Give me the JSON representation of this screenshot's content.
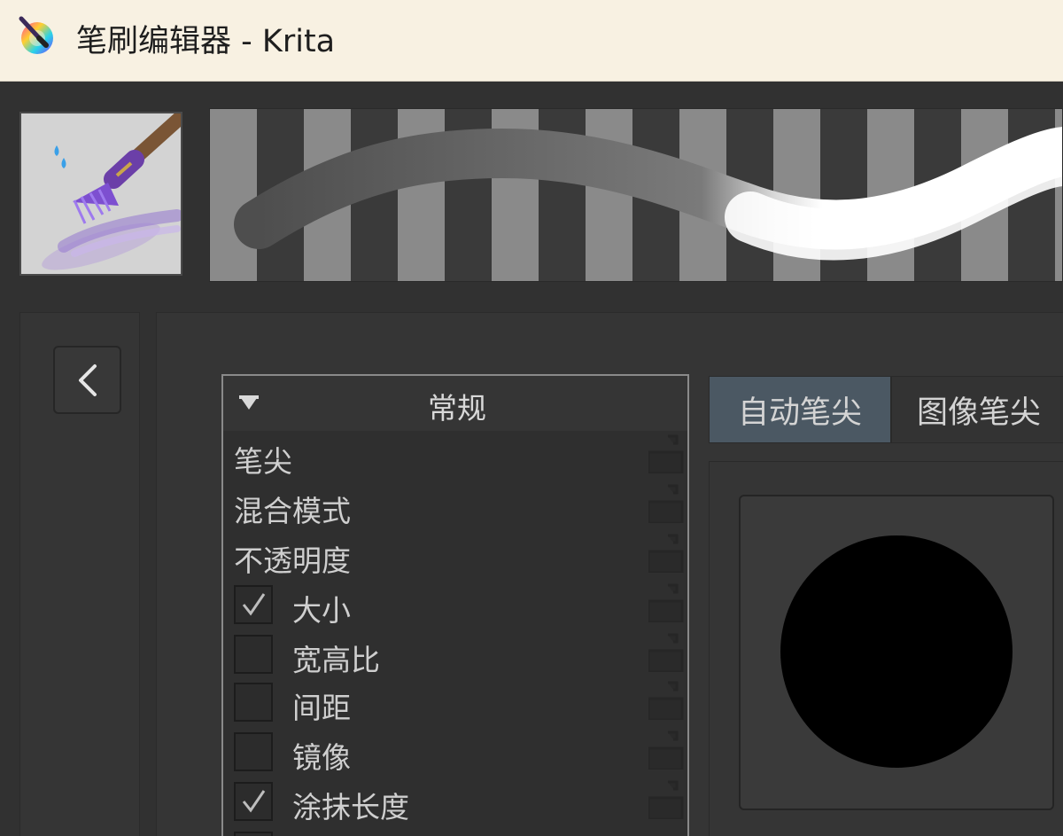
{
  "window": {
    "title": "笔刷编辑器 - Krita",
    "app_icon": "krita-logo-icon"
  },
  "preset": {
    "thumbnail_icon": "brush-preset-thumbnail-icon"
  },
  "navigation": {
    "back_icon": "chevron-left-icon"
  },
  "options": {
    "group_title": "常规",
    "items": [
      {
        "label": "笔尖",
        "checkbox": false
      },
      {
        "label": "混合模式",
        "checkbox": false
      },
      {
        "label": "不透明度",
        "checkbox": false
      },
      {
        "label": "大小",
        "checkbox": true,
        "checked": true
      },
      {
        "label": "宽高比",
        "checkbox": true,
        "checked": false
      },
      {
        "label": "间距",
        "checkbox": true,
        "checked": false
      },
      {
        "label": "镜像",
        "checkbox": true,
        "checked": false
      },
      {
        "label": "涂抹长度",
        "checkbox": true,
        "checked": true
      }
    ]
  },
  "tabs": [
    {
      "label": "自动笔尖",
      "active": true
    },
    {
      "label": "图像笔尖",
      "active": false
    }
  ],
  "colors": {
    "title_bar_bg": "#f8f1e2",
    "panel_bg": "#353535",
    "active_tab_bg": "#4b5863",
    "brush_tip": "#000000"
  }
}
